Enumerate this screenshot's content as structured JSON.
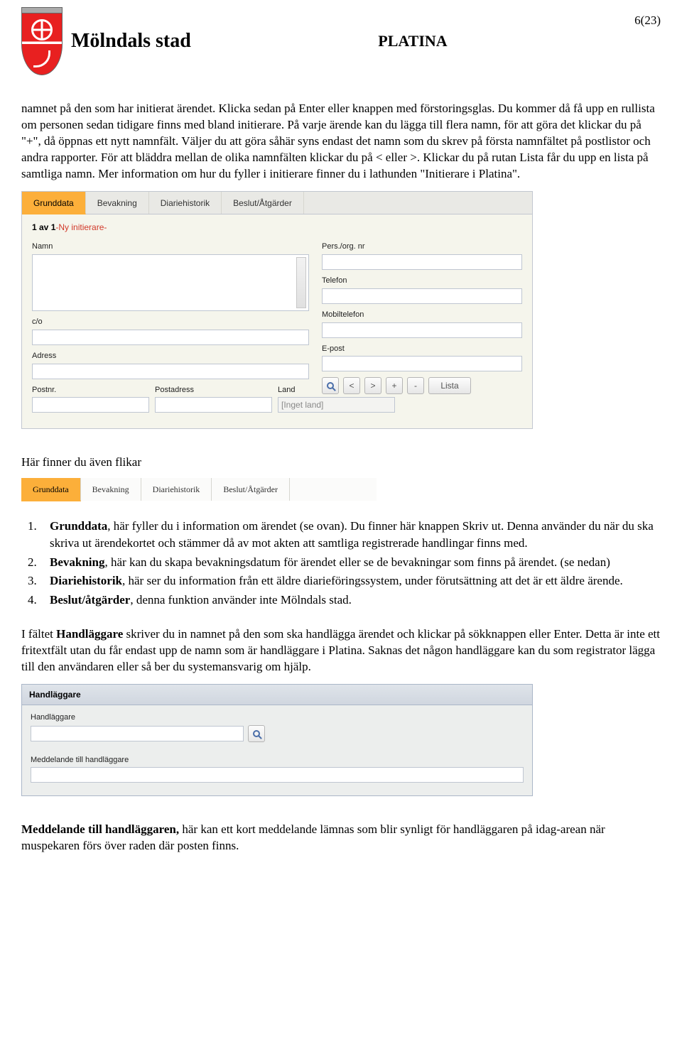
{
  "header": {
    "brand": "Mölndals stad",
    "center": "PLATINA",
    "pageno": "6(23)"
  },
  "para1": "namnet på den som har initierat ärendet. Klicka sedan på Enter eller knappen med förstoringsglas. Du kommer då få upp en rullista om personen sedan tidigare finns med bland initierare. På varje ärende kan du lägga till flera namn, för att göra det klickar du på \"+\", då öppnas ett nytt namnfält. Väljer du att göra såhär syns endast det namn som du skrev på första namnfältet på postlistor och andra rapporter. För att bläddra mellan de olika namnfälten klickar du på < eller >. Klickar du på rutan Lista får du upp en lista på samtliga namn. Mer information om hur du fyller i initierare finner du i lathunden \"Initierare i Platina\".",
  "form1": {
    "tabs": [
      "Grunddata",
      "Bevakning",
      "Diariehistorik",
      "Beslut/Åtgärder"
    ],
    "count_prefix": "1 av 1",
    "count_suffix": "-Ny initierare-",
    "labels": {
      "namn": "Namn",
      "persorg": "Pers./org. nr",
      "telefon": "Telefon",
      "co": "c/o",
      "mobil": "Mobiltelefon",
      "adress": "Adress",
      "epost": "E-post",
      "postnr": "Postnr.",
      "postadress": "Postadress",
      "land": "Land",
      "land_value": "[Inget land]",
      "lista": "Lista"
    },
    "buttons": {
      "prev": "<",
      "next": ">",
      "plus": "+",
      "minus": "-"
    }
  },
  "para2": "Här finner du även flikar",
  "tabs2": [
    "Grunddata",
    "Bevakning",
    "Diariehistorik",
    "Beslut/Åtgärder"
  ],
  "list": {
    "i1_bold": "Grunddata",
    "i1_rest": ", här fyller du i information om ärendet (se ovan). Du finner här knappen Skriv ut. Denna använder du när du ska skriva ut ärendekortet och stämmer då av mot akten att samtliga registrerade handlingar finns med.",
    "i2_bold": "Bevakning",
    "i2_rest": ", här kan du skapa bevakningsdatum för ärendet eller se de bevakningar som finns på ärendet. (se nedan)",
    "i3_bold": "Diariehistorik",
    "i3_rest": ", här ser du information från ett äldre diarieföringssystem, under förutsättning att det är ett äldre ärende.",
    "i4_bold": "Beslut/åtgärder",
    "i4_rest": ", denna funktion använder inte Mölndals stad."
  },
  "para3_a": "I fältet ",
  "para3_bold": "Handläggare",
  "para3_b": " skriver du in namnet på den som ska handlägga ärendet och klickar på sökknappen eller Enter. Detta är inte ett fritextfält utan du får endast upp de namn som är handläggare i Platina. Saknas det någon handläggare kan du som registrator lägga till den användaren eller så ber du systemansvarig om hjälp.",
  "form2": {
    "title": "Handläggare",
    "handlaggare": "Handläggare",
    "meddelande": "Meddelande till handläggare"
  },
  "para4_bold": "Meddelande till handläggaren,",
  "para4_rest": " här kan ett kort meddelande lämnas som blir synligt för handläggaren på idag-arean när muspekaren förs över raden där posten finns."
}
